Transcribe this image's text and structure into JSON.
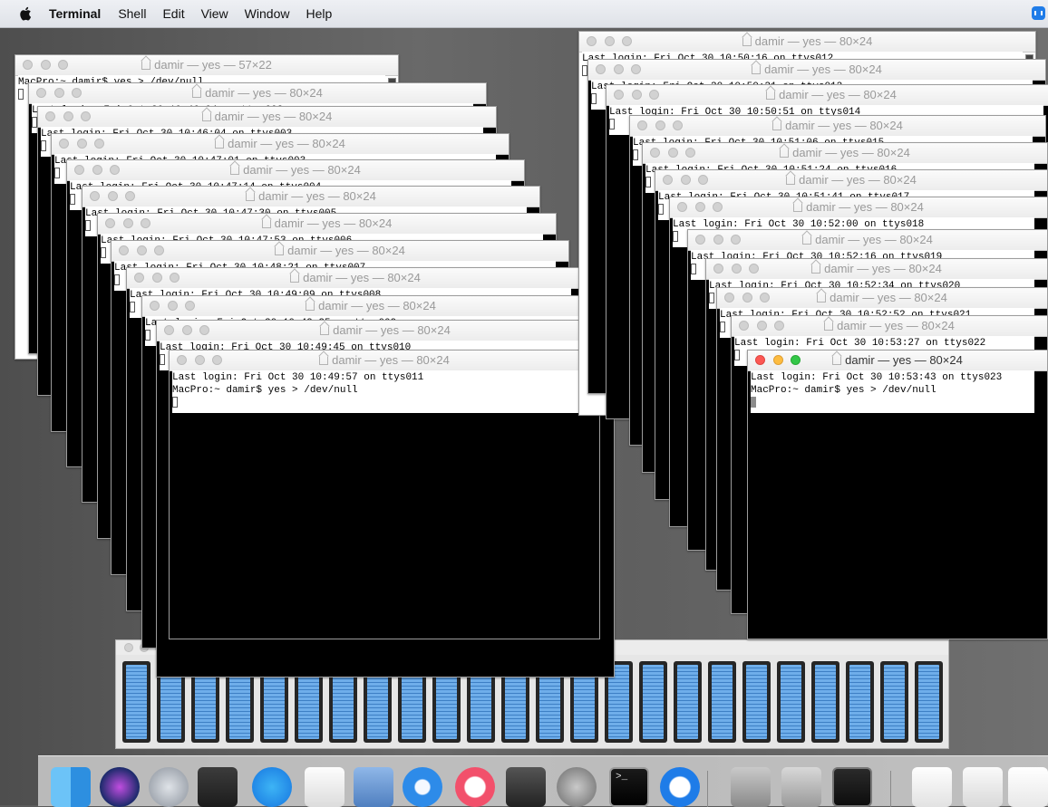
{
  "menubar": {
    "app_name": "Terminal",
    "items": [
      "Shell",
      "Edit",
      "View",
      "Window",
      "Help"
    ]
  },
  "windows": [
    {
      "title": "damir — yes — 57×22",
      "lines": [
        "MacPro:~ damir$ yes > /dev/null"
      ]
    },
    {
      "title": "damir — yes — 80×24",
      "lines": [
        "Last login: Fri Oct 30 10:46:04 on ttys002"
      ]
    },
    {
      "title": "damir — yes — 80×24",
      "lines": [
        "Last login: Fri Oct 30 10:46:04 on ttys003"
      ]
    },
    {
      "title": "damir — yes — 80×24",
      "lines": [
        "Last login: Fri Oct 30 10:47:01 on ttys003"
      ]
    },
    {
      "title": "damir — yes — 80×24",
      "lines": [
        "Last login: Fri Oct 30 10:47:14 on ttys004"
      ]
    },
    {
      "title": "damir — yes — 80×24",
      "lines": [
        "Last login: Fri Oct 30 10:47:30 on ttys005"
      ]
    },
    {
      "title": "damir — yes — 80×24",
      "lines": [
        "Last login: Fri Oct 30 10:47:53 on ttys006"
      ]
    },
    {
      "title": "damir — yes — 80×24",
      "lines": [
        "Last login: Fri Oct 30 10:48:21 on ttys007"
      ]
    },
    {
      "title": "damir — yes — 80×24",
      "lines": [
        "Last login: Fri Oct 30 10:49:09 on ttys008"
      ]
    },
    {
      "title": "damir — yes — 80×24",
      "lines": [
        "Last login: Fri Oct 30 10:49:25 on ttys009"
      ]
    },
    {
      "title": "damir — yes — 80×24",
      "lines": [
        "Last login: Fri Oct 30 10:49:45 on ttys010"
      ]
    },
    {
      "title": "damir — yes — 80×24",
      "lines": [
        "Last login: Fri Oct 30 10:49:57 on ttys011",
        "MacPro:~ damir$ yes > /dev/null"
      ]
    },
    {
      "title": "damir — yes — 80×24",
      "lines": [
        "Last login: Fri Oct 30 10:50:16 on ttys012"
      ]
    },
    {
      "title": "damir — yes — 80×24",
      "lines": [
        "Last login: Fri Oct 30 10:50:31 on ttys013"
      ]
    },
    {
      "title": "damir — yes — 80×24",
      "lines": [
        "Last login: Fri Oct 30 10:50:51 on ttys014"
      ]
    },
    {
      "title": "damir — yes — 80×24",
      "lines": [
        "Last login: Fri Oct 30 10:51:06 on ttys015"
      ]
    },
    {
      "title": "damir — yes — 80×24",
      "lines": [
        "Last login: Fri Oct 30 10:51:24 on ttys016"
      ]
    },
    {
      "title": "damir — yes — 80×24",
      "lines": [
        "Last login: Fri Oct 30 10:51:41 on ttys017"
      ]
    },
    {
      "title": "damir — yes — 80×24",
      "lines": [
        "Last login: Fri Oct 30 10:52:00 on ttys018"
      ]
    },
    {
      "title": "damir — yes — 80×24",
      "lines": [
        "Last login: Fri Oct 30 10:52:16 on ttys019"
      ]
    },
    {
      "title": "damir — yes — 80×24",
      "lines": [
        "Last login: Fri Oct 30 10:52:34 on ttys020"
      ]
    },
    {
      "title": "damir — yes — 80×24",
      "lines": [
        "Last login: Fri Oct 30 10:52:52 on ttys021"
      ]
    },
    {
      "title": "damir — yes — 80×24",
      "lines": [
        "Last login: Fri Oct 30 10:53:27 on ttys022"
      ]
    },
    {
      "title": "damir — yes — 80×24",
      "lines": [
        "Last login: Fri Oct 30 10:53:43 on ttys023",
        "MacPro:~ damir$ yes > /dev/null"
      ]
    }
  ],
  "cpu_meter": {
    "core_count": 24,
    "core_loads": [
      1,
      1,
      1,
      1,
      1,
      1,
      1,
      1,
      1,
      1,
      1,
      1,
      1,
      1,
      1,
      1,
      1,
      1,
      1,
      1,
      1,
      1,
      1,
      1
    ]
  },
  "dock": {
    "icons": [
      "finder-icon",
      "siri-icon",
      "launchpad-icon",
      "photo-browser-icon",
      "app-store-icon",
      "textedit-icon",
      "mail-icon",
      "safari-icon",
      "itunes-icon",
      "disk-utility-icon",
      "system-preferences-icon",
      "terminal-icon",
      "teamviewer-icon",
      "system-information-icon",
      "archive-utility-icon",
      "activity-monitor-icon",
      "document-icon",
      "downloads-folder-icon",
      "screenshot-icon"
    ]
  }
}
